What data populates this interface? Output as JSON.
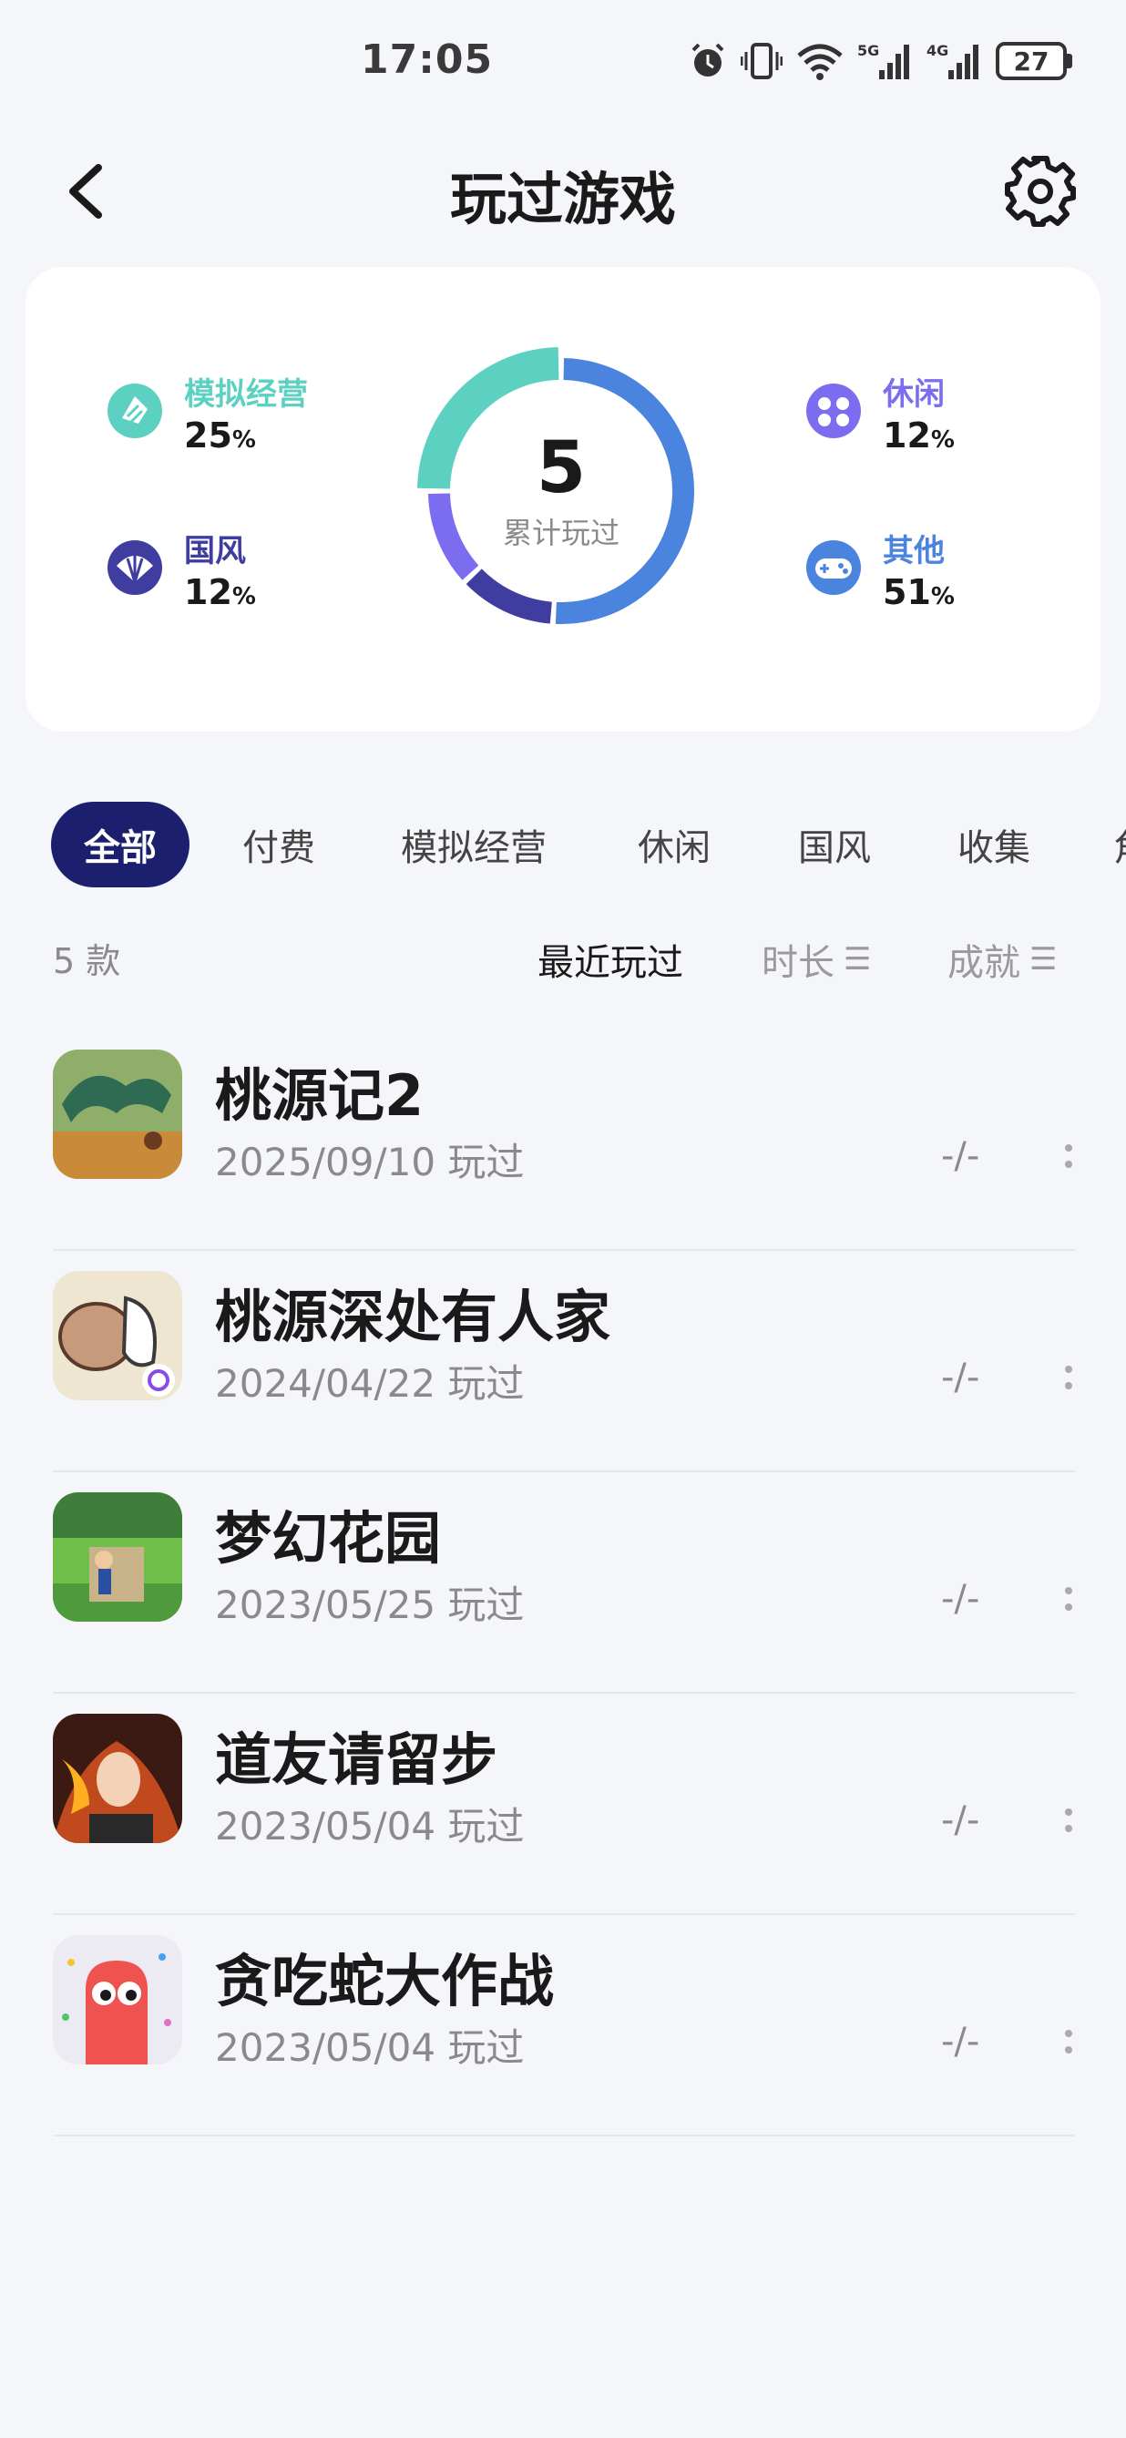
{
  "status": {
    "time": "17:05",
    "battery": "27",
    "net1": "5G",
    "net2": "4G"
  },
  "header": {
    "title": "玩过游戏"
  },
  "stats": {
    "total": "5",
    "total_label": "累计玩过",
    "categories": [
      {
        "label": "模拟经营",
        "value": "25",
        "unit": "%",
        "color": "#5cd1c1",
        "icon": "leaf-icon"
      },
      {
        "label": "国风",
        "value": "12",
        "unit": "%",
        "color": "#3f3ea0",
        "icon": "fan-icon"
      },
      {
        "label": "休闲",
        "value": "12",
        "unit": "%",
        "color": "#7b6cf0",
        "icon": "dice-icon"
      },
      {
        "label": "其他",
        "value": "51",
        "unit": "%",
        "color": "#4a84de",
        "icon": "gamepad-icon"
      }
    ]
  },
  "chart_data": {
    "type": "pie",
    "categories": [
      "模拟经营",
      "国风",
      "休闲",
      "其他"
    ],
    "values": [
      25,
      12,
      12,
      51
    ],
    "colors": [
      "#5cd1c1",
      "#3f3ea0",
      "#7b6cf0",
      "#4a84de"
    ]
  },
  "tabs": [
    "全部",
    "付费",
    "模拟经营",
    "休闲",
    "国风",
    "收集",
    "角"
  ],
  "sort": {
    "count": "5 款",
    "recent": "最近玩过",
    "duration": "时长",
    "achievement": "成就"
  },
  "games": [
    {
      "name": "桃源记2",
      "date": "2025/09/10 玩过",
      "duration": "-/-"
    },
    {
      "name": "桃源深处有人家",
      "date": "2024/04/22 玩过",
      "duration": "-/-"
    },
    {
      "name": "梦幻花园",
      "date": "2023/05/25 玩过",
      "duration": "-/-"
    },
    {
      "name": "道友请留步",
      "date": "2023/05/04 玩过",
      "duration": "-/-"
    },
    {
      "name": "贪吃蛇大作战",
      "date": "2023/05/04 玩过",
      "duration": "-/-"
    }
  ]
}
